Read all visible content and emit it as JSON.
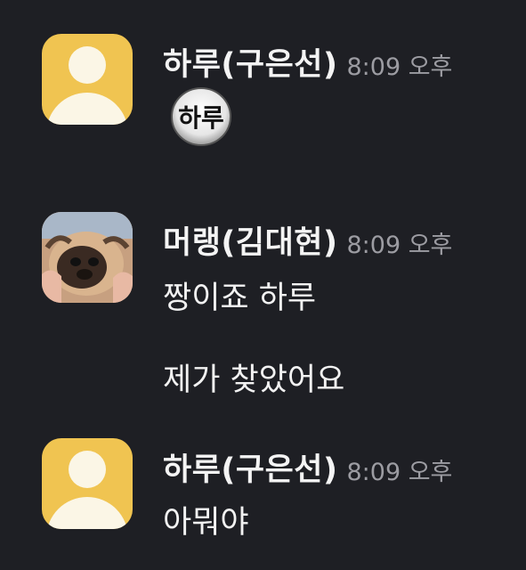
{
  "messages": [
    {
      "sender": "하루(구은선)",
      "time": "8:09 오후",
      "emoticon_text": "하루"
    },
    {
      "sender": "머랭(김대현)",
      "time": "8:09 오후",
      "lines": [
        "짱이죠 하루",
        "제가 찾았어요"
      ]
    },
    {
      "sender": "하루(구은선)",
      "time": "8:09 오후",
      "lines": [
        "아뭐야"
      ]
    }
  ],
  "colors": {
    "background": "#1e1f24",
    "default_avatar": "#f0c451",
    "time_text": "#9c9ca2"
  }
}
